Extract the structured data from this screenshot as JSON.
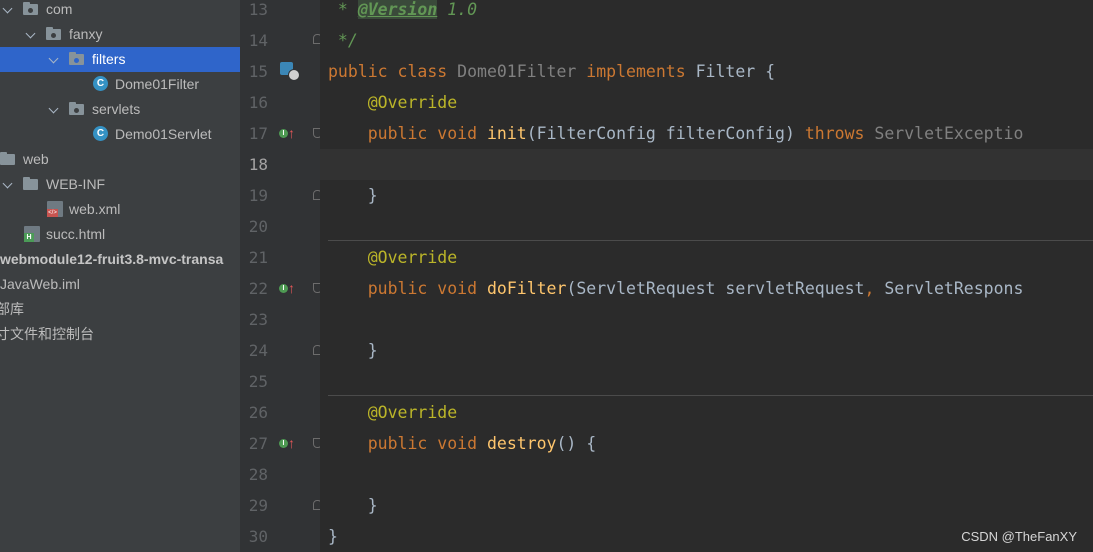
{
  "tree": {
    "items": [
      {
        "label": "com",
        "type": "package",
        "expanded": true
      },
      {
        "label": "fanxy",
        "type": "package",
        "expanded": true
      },
      {
        "label": "filters",
        "type": "package",
        "expanded": true,
        "selected": true
      },
      {
        "label": "Dome01Filter",
        "type": "class"
      },
      {
        "label": "servlets",
        "type": "package",
        "expanded": true
      },
      {
        "label": "Demo01Servlet",
        "type": "class"
      },
      {
        "label": "web",
        "type": "folder"
      },
      {
        "label": "WEB-INF",
        "type": "folder",
        "expanded": true
      },
      {
        "label": "web.xml",
        "type": "xml"
      },
      {
        "label": "succ.html",
        "type": "html"
      },
      {
        "label": "webmodule12-fruit3.8-mvc-transa",
        "type": "module"
      },
      {
        "label": "JavaWeb.iml",
        "type": "file"
      },
      {
        "label": "部库",
        "type": "text"
      },
      {
        "label": "寸文件和控制台",
        "type": "text"
      }
    ],
    "class_icon_letter": "C",
    "xml_badge": "</>",
    "html_badge": "H"
  },
  "gutter": {
    "line_numbers": [
      "13",
      "14",
      "15",
      "16",
      "17",
      "18",
      "19",
      "20",
      "21",
      "22",
      "23",
      "24",
      "25",
      "26",
      "27",
      "28",
      "29",
      "30"
    ],
    "current_line": "18",
    "override_badge": "I"
  },
  "code": {
    "line13": {
      "star": " * ",
      "tag": "@Version",
      "rest": " 1.0"
    },
    "line14": {
      "text": " */"
    },
    "line15": {
      "kw": "public class ",
      "name": "Dome01Filter",
      "kw2": " implements ",
      "iface": "Filter {"
    },
    "line16": {
      "ann": "    @Override"
    },
    "line17": {
      "kw": "    public void ",
      "fn": "init",
      "args": "(FilterConfig filterConfig) ",
      "kw2": "throws ",
      "exc": "ServletExceptio"
    },
    "line18": {
      "text": ""
    },
    "line19": {
      "text": "    }"
    },
    "line20": {
      "text": ""
    },
    "line21": {
      "ann": "    @Override"
    },
    "line22": {
      "kw": "    public void ",
      "fn": "doFilter",
      "args": "(ServletRequest servletRequest",
      "comma": ", ",
      "args2": "ServletRespons"
    },
    "line23": {
      "text": ""
    },
    "line24": {
      "text": "    }"
    },
    "line25": {
      "text": ""
    },
    "line26": {
      "ann": "    @Override"
    },
    "line27": {
      "kw": "    public void ",
      "fn": "destroy",
      "args": "() {"
    },
    "line28": {
      "text": ""
    },
    "line29": {
      "text": "    }"
    },
    "line30": {
      "text": "}"
    }
  },
  "watermark": "CSDN @TheFanXY",
  "colors": {
    "tree_bg": "#3c3f41",
    "selection": "#2f65ca",
    "editor_bg": "#2b2b2b",
    "keyword": "#cc7832",
    "annotation": "#bbb529",
    "function": "#ffc66d",
    "comment": "#629755"
  }
}
